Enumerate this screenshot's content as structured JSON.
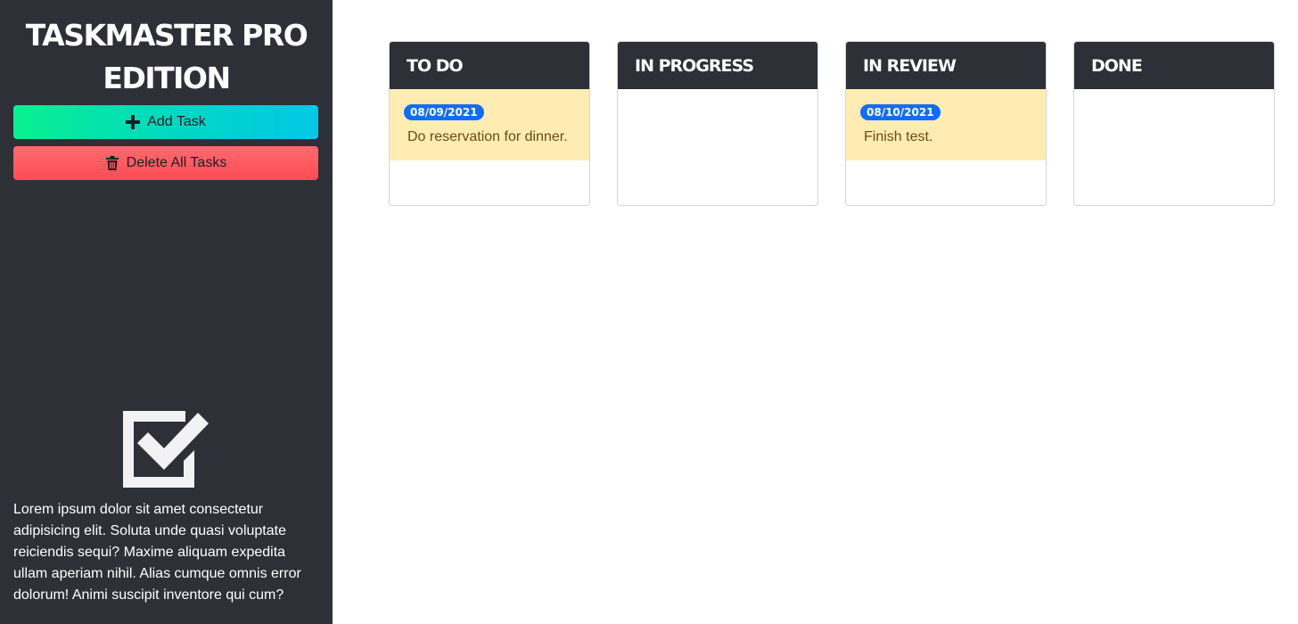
{
  "app": {
    "title_line1": "TASKMASTER PRO",
    "title_line2": "EDITION"
  },
  "sidebar": {
    "add_label": "Add Task",
    "delete_label": "Delete All Tasks",
    "add_icon": "plus-icon",
    "delete_icon": "trash-icon",
    "logo_icon": "checkbox-icon",
    "blurb": "Lorem ipsum dolor sit amet consectetur adipisicing elit. Soluta unde quasi voluptate reiciendis sequi? Maxime aliquam expedita ullam aperiam nihil. Alias cumque omnis error dolorum! Animi suscipit inventore qui cum?"
  },
  "board": {
    "columns": [
      {
        "title": "TO DO",
        "tasks": [
          {
            "date": "08/09/2021",
            "text": "Do reservation for dinner."
          }
        ]
      },
      {
        "title": "IN PROGRESS",
        "tasks": []
      },
      {
        "title": "IN REVIEW",
        "tasks": [
          {
            "date": "08/10/2021",
            "text": "Finish test."
          }
        ]
      },
      {
        "title": "DONE",
        "tasks": []
      }
    ]
  },
  "colors": {
    "sidebar_bg": "#2d3037",
    "card_bg": "#ffecb3",
    "badge": "#0d6efd",
    "add_gradient": [
      "#08f08f",
      "#02c8e6"
    ],
    "delete_gradient": [
      "#ff6b6f",
      "#ff4b55"
    ]
  }
}
